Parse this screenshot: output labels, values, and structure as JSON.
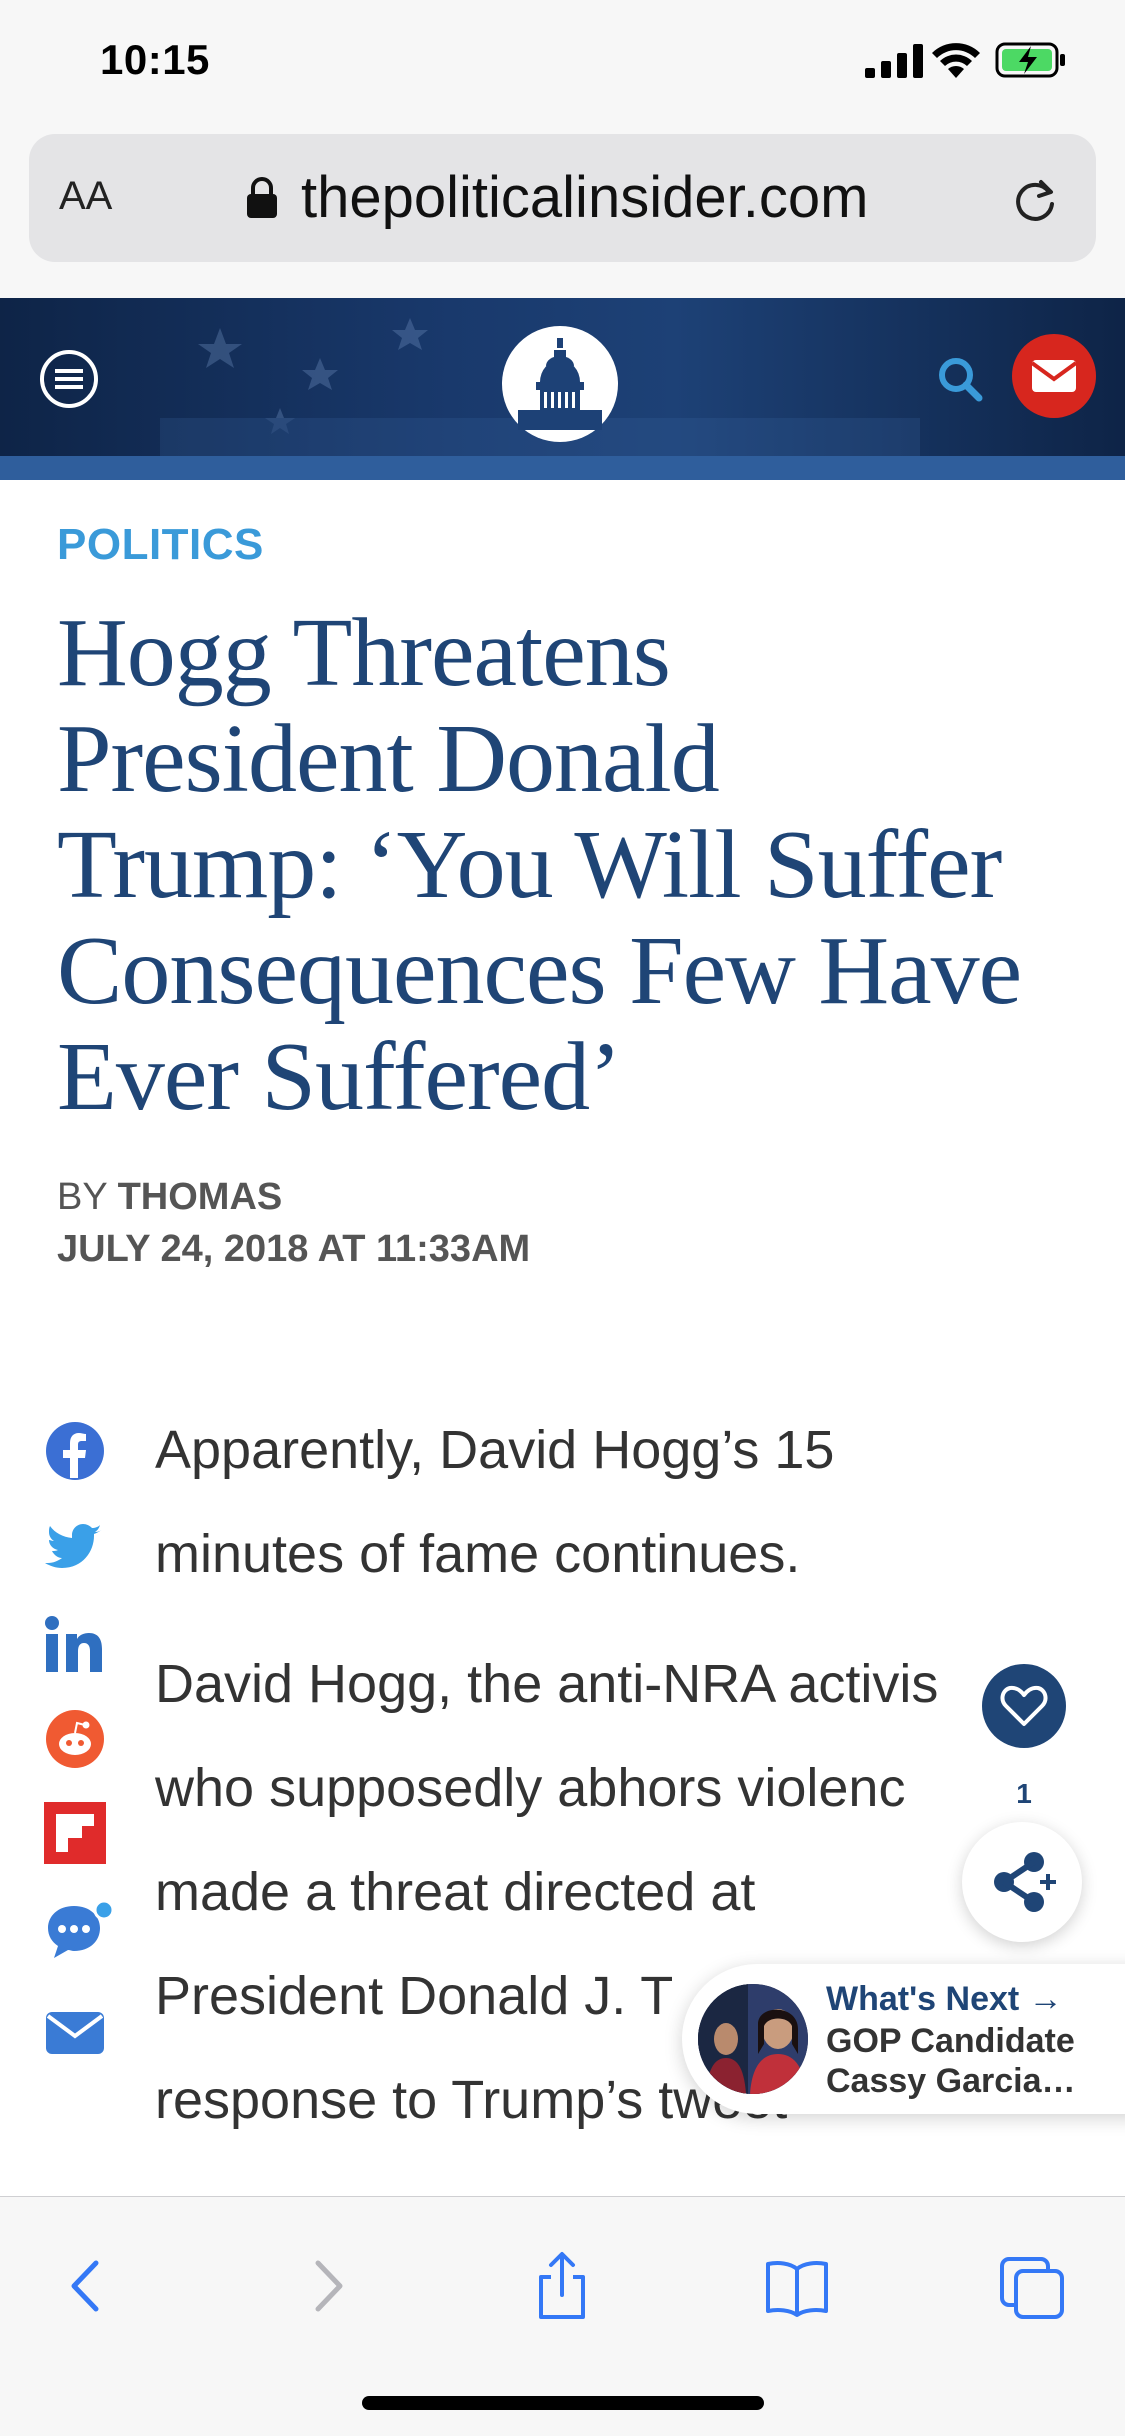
{
  "status": {
    "time": "10:15"
  },
  "url_bar": {
    "text_size_label": "AA",
    "domain": "thepoliticalinsider.com"
  },
  "site_header": {
    "menu_icon": "menu-icon",
    "logo_icon": "capitol-dome-icon",
    "search_icon": "search-icon",
    "newsletter_icon": "mail-icon"
  },
  "article": {
    "category": "POLITICS",
    "headline_lines": [
      "Hogg Threatens",
      "President Donald",
      "Trump: ‘You Will Suffer",
      "Consequences Few Have",
      "Ever Suffered’"
    ],
    "byline_prefix": "BY",
    "author": "THOMAS",
    "date": "JULY 24, 2018 AT 11:33AM",
    "paragraph1_lines": [
      "Apparently, David Hogg’s 15",
      "minutes of fame continues."
    ],
    "paragraph2_lines": [
      "David Hogg, the anti-NRA activis",
      "who supposedly abhors violenc",
      "made a threat directed at",
      "President Donald J. T",
      "response to Trump’s tweet"
    ]
  },
  "share_rail": [
    "facebook-icon",
    "twitter-icon",
    "linkedin-icon",
    "reddit-icon",
    "flipboard-icon",
    "comment-icon",
    "email-icon"
  ],
  "reactions": {
    "count": "1"
  },
  "whats_next": {
    "label": "What's Next →",
    "title_line1": "GOP Candidate",
    "title_line2": "Cassy Garcia…"
  },
  "colors": {
    "brand_navy": "#1f4576",
    "category_blue": "#3a9ad9",
    "mail_red": "#d7261e",
    "ios_blue": "#3478f6"
  },
  "toolbar": [
    "back-icon",
    "forward-icon",
    "share-icon",
    "bookmarks-icon",
    "tabs-icon"
  ]
}
